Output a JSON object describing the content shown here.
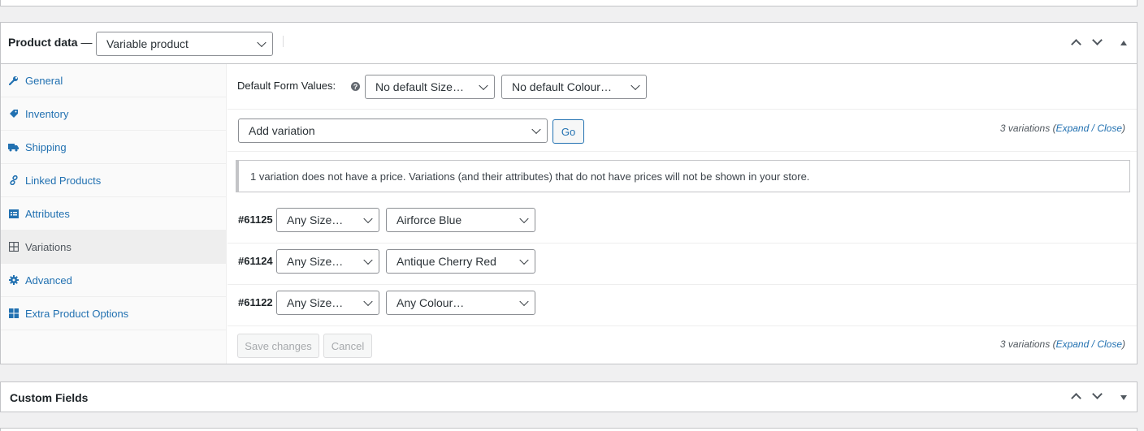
{
  "product_data": {
    "title": "Product data",
    "title_dash": "—",
    "product_type": "Variable product"
  },
  "sidebar": {
    "items": [
      {
        "label": "General",
        "icon": "wrench-icon",
        "active": false
      },
      {
        "label": "Inventory",
        "icon": "tag-icon",
        "active": false
      },
      {
        "label": "Shipping",
        "icon": "truck-icon",
        "active": false
      },
      {
        "label": "Linked Products",
        "icon": "link-icon",
        "active": false
      },
      {
        "label": "Attributes",
        "icon": "list-card-icon",
        "active": false
      },
      {
        "label": "Variations",
        "icon": "grid-icon",
        "active": true
      },
      {
        "label": "Advanced",
        "icon": "gear-icon",
        "active": false
      },
      {
        "label": "Extra Product Options",
        "icon": "windows-icon",
        "active": false
      }
    ]
  },
  "defaults": {
    "label": "Default Form Values:",
    "size_value": "No default Size…",
    "colour_value": "No default Colour…"
  },
  "add_variation": {
    "select_value": "Add variation",
    "go_label": "Go"
  },
  "variation_count": {
    "text": "3 variations",
    "expand": "Expand",
    "sep": "/",
    "close": "Close"
  },
  "notice": "1 variation does not have a price. Variations (and their attributes) that do not have prices will not be shown in your store.",
  "variations": [
    {
      "id": "#61125",
      "size": "Any Size…",
      "colour": "Airforce Blue"
    },
    {
      "id": "#61124",
      "size": "Any Size…",
      "colour": "Antique Cherry Red"
    },
    {
      "id": "#61122",
      "size": "Any Size…",
      "colour": "Any Colour…"
    }
  ],
  "buttons": {
    "save": "Save changes",
    "cancel": "Cancel"
  },
  "custom_fields": {
    "title": "Custom Fields"
  },
  "colors": {
    "link": "#2271b1",
    "border": "#c3c4c7",
    "background": "#f0f0f1"
  }
}
